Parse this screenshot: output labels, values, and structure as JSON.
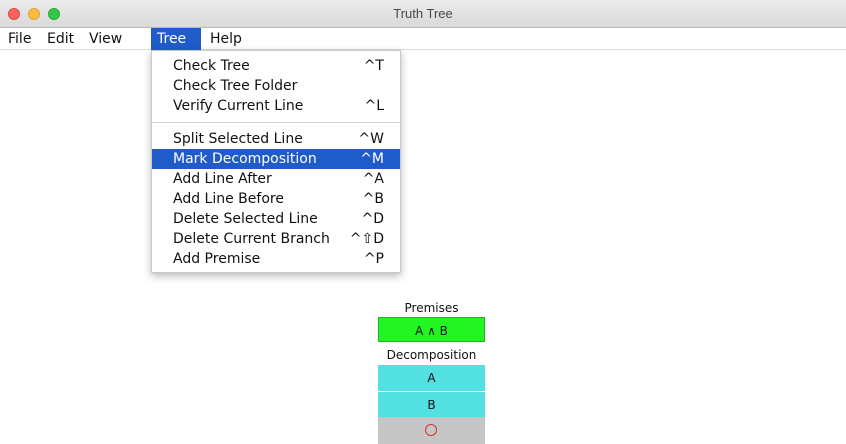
{
  "window": {
    "title": "Truth Tree"
  },
  "menubar": {
    "items": [
      {
        "label": "File"
      },
      {
        "label": "Edit"
      },
      {
        "label": "View"
      },
      {
        "label": "Tree",
        "open": true
      },
      {
        "label": "Help"
      }
    ]
  },
  "tree_menu": {
    "items": [
      {
        "label": "Check Tree",
        "shortcut": "^T"
      },
      {
        "label": "Check Tree Folder",
        "shortcut": ""
      },
      {
        "label": "Verify Current Line",
        "shortcut": "^L"
      },
      {
        "label": "Split Selected Line",
        "shortcut": "^W"
      },
      {
        "label": "Mark Decomposition",
        "shortcut": "^M",
        "highlighted": true
      },
      {
        "label": "Add Line After",
        "shortcut": "^A"
      },
      {
        "label": "Add Line Before",
        "shortcut": "^B"
      },
      {
        "label": "Delete Selected Line",
        "shortcut": "^D"
      },
      {
        "label": "Delete Current Branch",
        "shortcut": "^⇧D"
      },
      {
        "label": "Add Premise",
        "shortcut": "^P"
      }
    ]
  },
  "tree": {
    "premises_label": "Premises",
    "premise": "A ∧ B",
    "decomposition_label": "Decomposition",
    "lines": [
      "A",
      "B"
    ],
    "closure_icon": "red-circle-icon"
  },
  "colors": {
    "menu_highlight": "#1f5cc9",
    "premise_bg": "#22f522",
    "decomposition_bg": "#53e0e0",
    "closure_bg": "#c6c6c6",
    "closure_mark": "#d23333"
  }
}
